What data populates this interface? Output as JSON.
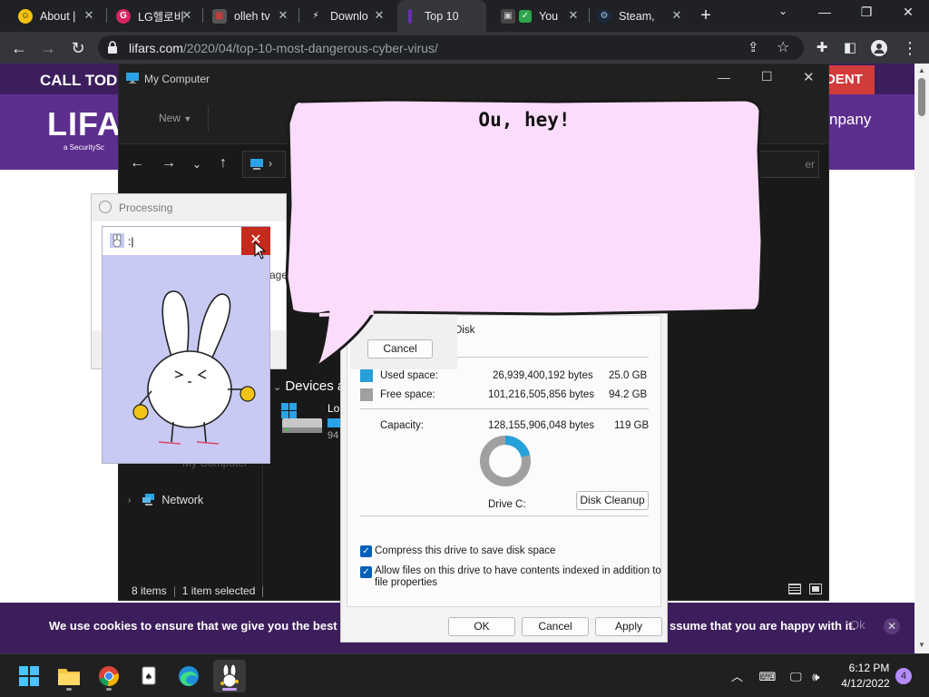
{
  "browser": {
    "tabs": [
      {
        "label": "About |"
      },
      {
        "label": "LG헬로비"
      },
      {
        "label": "olleh tv"
      },
      {
        "label": "Downlo"
      },
      {
        "label": "Top 10"
      },
      {
        "label": "You"
      },
      {
        "label": "Steam,"
      }
    ],
    "url_domain": "lifars.com",
    "url_path": "/2020/04/top-10-most-dangerous-cyber-virus/"
  },
  "website": {
    "call_today": "CALL TOD",
    "red_button": "DENT",
    "logo": "LIFA",
    "logo_sub": "a  SecuritySc",
    "company": "npany",
    "cookie_text_left": "We use cookies to ensure that we give you the best exp",
    "cookie_text_right": "ssume that you are happy with it.",
    "cookie_ok": "Ok"
  },
  "explorer": {
    "title": "My Computer",
    "new_label": "New",
    "search_placeholder": "er",
    "devices_header": "Devices a",
    "drive_label": "Lo",
    "drive_size": "94",
    "sidebar_my_computer": "My Computer",
    "network_label": "Network",
    "status_items": "8 items",
    "status_selected": "1 item selected"
  },
  "processing": {
    "title": "Processing",
    "page_text": "age",
    "cancel_label": "Cancel"
  },
  "properties": {
    "disk_label": "Disk",
    "used_label": "Used space:",
    "used_bytes": "26,939,400,192 bytes",
    "used_gb": "25.0 GB",
    "free_label": "Free space:",
    "free_bytes": "101,216,505,856 bytes",
    "free_gb": "94.2 GB",
    "capacity_label": "Capacity:",
    "capacity_bytes": "128,155,906,048 bytes",
    "capacity_gb": "119 GB",
    "used_fraction": 0.21,
    "drive_name": "Drive C:",
    "disk_cleanup": "Disk Cleanup",
    "compress_label": "Compress this drive to save disk space",
    "index_label_1": "Allow files on this drive to have contents indexed in addition to",
    "index_label_2": "file properties",
    "ok": "OK",
    "cancel": "Cancel",
    "apply": "Apply",
    "colors": {
      "used": "#26a0da",
      "free": "#a0a0a0"
    }
  },
  "bunny": {
    "title": ":|",
    "background": "#c8caf4"
  },
  "bubble": {
    "text": "Ou, hey!"
  },
  "taskbar": {
    "time": "6:12 PM",
    "date": "4/12/2022",
    "notifications": "4"
  }
}
